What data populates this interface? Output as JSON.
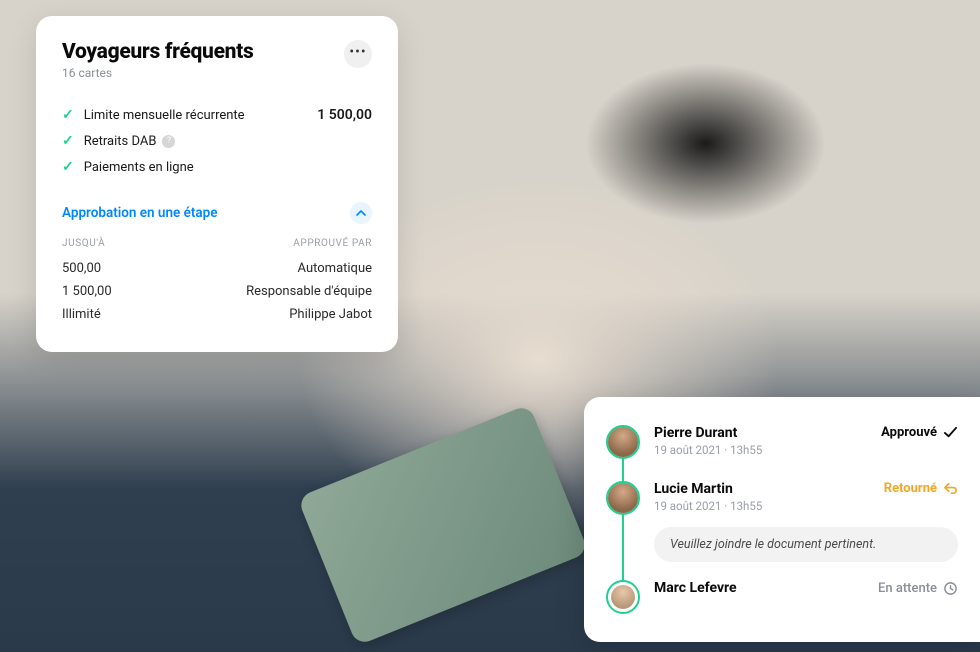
{
  "left_panel": {
    "title": "Voyageurs fréquents",
    "subtitle": "16 cartes",
    "features": [
      {
        "label": "Limite mensuelle récurrente",
        "value": "1 500,00",
        "help": false
      },
      {
        "label": "Retraits DAB",
        "value": "",
        "help": true
      },
      {
        "label": "Paiements en ligne",
        "value": "",
        "help": false
      }
    ],
    "approval_section": {
      "toggle_label": "Approbation en une étape",
      "col_left": "Jusqu'à",
      "col_right": "Approuvé par",
      "rows": [
        {
          "limit": "500,00",
          "approver": "Automatique"
        },
        {
          "limit": "1 500,00",
          "approver": "Responsable d'équipe"
        },
        {
          "limit": "Illimité",
          "approver": "Philippe Jabot"
        }
      ]
    }
  },
  "right_panel": {
    "items": [
      {
        "name": "Pierre Durant",
        "meta": "19 août 2021  ·  13h55",
        "status_label": "Approuvé",
        "status": "approved"
      },
      {
        "name": "Lucie Martin",
        "meta": "19 août 2021  ·  13h55",
        "status_label": "Retourné",
        "status": "returned",
        "comment": "Veuillez joindre le document pertinent."
      },
      {
        "name": "Marc Lefevre",
        "meta": "",
        "status_label": "En attente",
        "status": "pending"
      }
    ]
  }
}
